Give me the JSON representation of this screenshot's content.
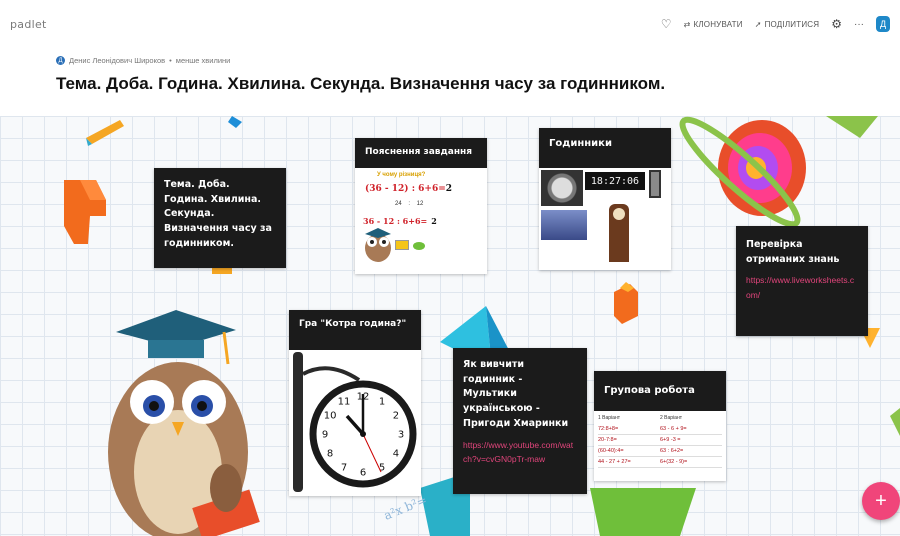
{
  "app": {
    "logo": "padlet"
  },
  "toolbar": {
    "clone_label": "КЛОНУВАТИ",
    "share_label": "ПОДІЛИТИСЯ",
    "more_label": "···",
    "avatar_initial": "Д"
  },
  "header": {
    "author_initial": "Д",
    "author": "Денис Леонідович Широков",
    "separator": "•",
    "subtitle": "менше хвилини",
    "title": "Тема. Доба. Година. Хвилина. Секунда. Визначення часу за годинником."
  },
  "cards": {
    "topic": {
      "text": "Тема. Доба. Година. Хвилина. Секунда. Визначення часу за годинником."
    },
    "task": {
      "header": "Пояснення завдання",
      "question": "У чому різниця?",
      "expr1": "(36 - 12) : 6+6=",
      "expr1_result": "2",
      "expr1_sub": "24    :    12",
      "expr2": "36 - 12 : 6+6=",
      "expr2_result": "2"
    },
    "clocks": {
      "header": "Годинники",
      "digital": "18:27:06"
    },
    "check": {
      "header": "Перевірка отриманих знань",
      "link": "https://www.liveworksheets.com/"
    },
    "game": {
      "header": "Гра \"Котра година?\"",
      "clock_numbers": [
        "12",
        "1",
        "2",
        "3",
        "4",
        "5",
        "6",
        "7",
        "8",
        "9",
        "10",
        "11"
      ]
    },
    "video": {
      "header": "Як вивчити годинник - Мультики українською - Пригоди Хмаринки",
      "link": "https://www.youtube.com/watch?v=cvGN0pTr-maw"
    },
    "group": {
      "header": "Групова робота",
      "col1_title": "1 Варіант",
      "col2_title": "2 Варіант",
      "col1": [
        "72:8+8=",
        "20-7:8=",
        "(60-40):4=",
        "44 - 27 + 27="
      ],
      "col2": [
        "63 - 6 + 9=",
        "6+9 -3 =",
        "63 : 6+2=",
        "6+(32 - 9)="
      ]
    }
  },
  "fab": {
    "label": "+"
  },
  "colors": {
    "accent": "#f0457a",
    "card_dark": "#1b1b1b",
    "link": "#e0457b"
  }
}
